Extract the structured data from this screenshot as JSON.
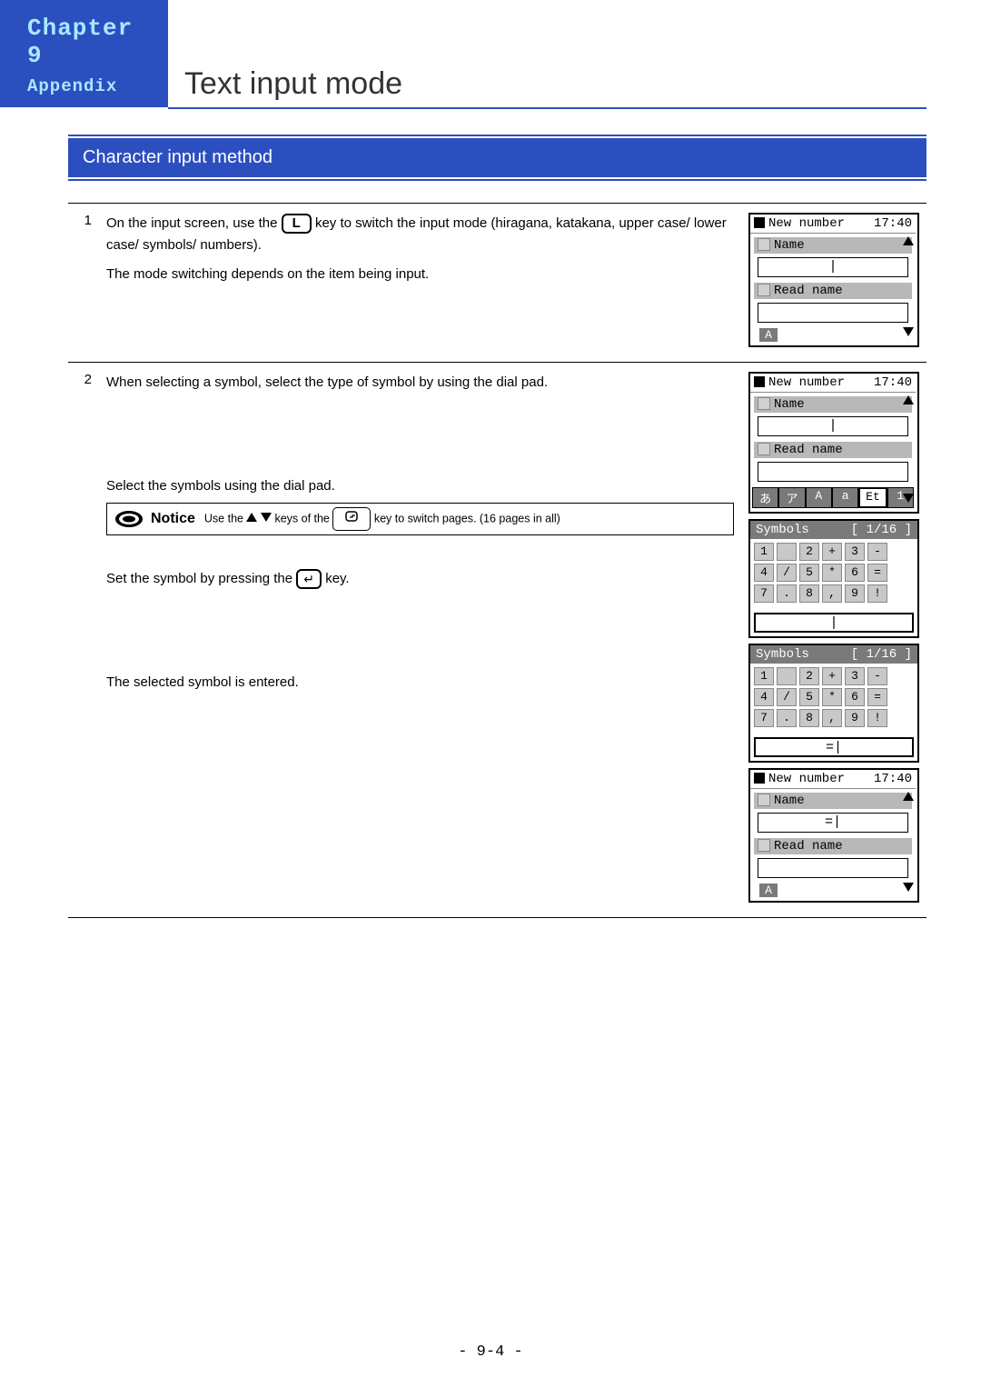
{
  "header": {
    "chapter_label": "Chapter 9",
    "subtitle": "Appendix",
    "page_title": "Text input mode"
  },
  "section": {
    "heading": "Character input method"
  },
  "steps": {
    "row1": {
      "num": "1",
      "t1a": "On the input screen, use the ",
      "key_L": "L",
      "t1b": " key to switch the input mode (hiragana, katakana, upper case/ lower case/ symbols/ numbers).",
      "t2": "The mode switching depends on the item being input."
    },
    "row2": {
      "num": "2",
      "t1": "When selecting a symbol, select the type of symbol by using the dial pad.",
      "t2": "Select the symbols using the dial pad.",
      "notice_label": "Notice",
      "notice_t_a": "Use the ",
      "notice_t_b": " keys of the ",
      "notice_t_c": " key to switch pages. (16 pages in all)",
      "t3a": "Set the symbol by pressing the ",
      "t3b": " key.",
      "t4": "The selected symbol is entered."
    }
  },
  "phone": {
    "title": "New number",
    "time": "17:40",
    "name_lbl": "Name",
    "read_lbl": "Read name",
    "badge_A": "A",
    "modes": [
      "あ",
      "ア",
      "A",
      "a",
      "Et",
      "1"
    ],
    "sym_title": "Symbols",
    "sym_page": "[ 1/16 ]",
    "grid_r1": [
      "1",
      "",
      "2",
      "+",
      "3",
      "-"
    ],
    "grid_r2": [
      "4",
      "/",
      "5",
      "*",
      "6",
      "="
    ],
    "grid_r3": [
      "7",
      ".",
      "8",
      ",",
      "9",
      "!"
    ],
    "cursor": "|",
    "eq_cursor": "=|",
    "eq_cursor2": "=|"
  },
  "footer": {
    "page": "- 9-4 -"
  }
}
